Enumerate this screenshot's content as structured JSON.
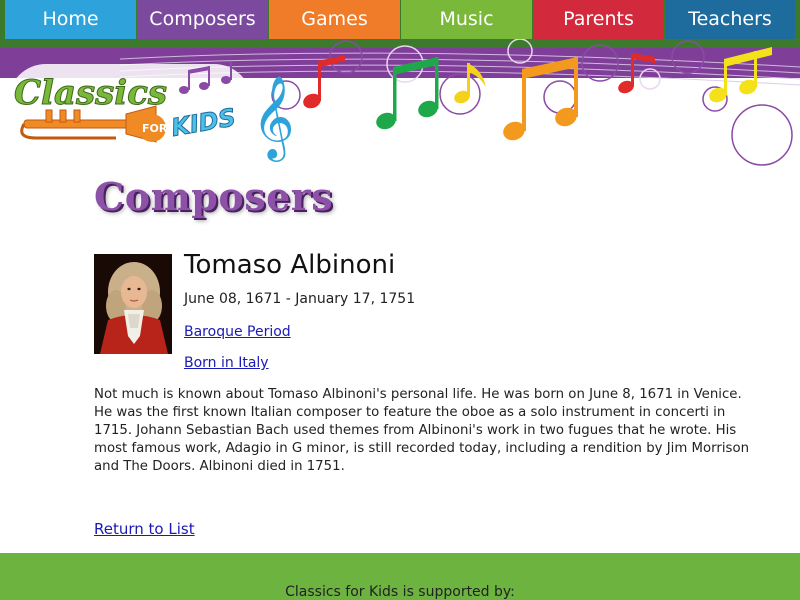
{
  "nav": {
    "items": [
      {
        "label": "Home",
        "color": "#2ea3db"
      },
      {
        "label": "Composers",
        "color": "#7b4a9e"
      },
      {
        "label": "Games",
        "color": "#f07b28"
      },
      {
        "label": "Music",
        "color": "#7ab83a"
      },
      {
        "label": "Parents",
        "color": "#d2293c"
      },
      {
        "label": "Teachers",
        "color": "#1e6c9e"
      }
    ]
  },
  "logo": {
    "text_main": "Classics",
    "text_for": "FOR",
    "text_kids": "KIDS",
    "icon": "trumpet-icon"
  },
  "page": {
    "title": "Composers"
  },
  "composer": {
    "name": "Tomaso Albinoni",
    "dates": "June 08, 1671 - January 17, 1751",
    "period_link": "Baroque Period",
    "born_link": "Born in Italy",
    "bio": "Not much is known about Tomaso Albinoni's personal life. He was born on June 8, 1671 in Venice. He was the first known Italian composer to feature the oboe as a solo instrument in concerti in 1715. Johann Sebastian Bach used themes from Albinoni's work in two fugues that he wrote. His most famous work, Adagio in G minor, is still recorded today, including a rendition by Jim Morrison and The Doors. Albinoni died in 1751."
  },
  "return_link": "Return to List",
  "footer": {
    "supported_text": "Classics for Kids is supported by:"
  },
  "colors": {
    "purple": "#7f3f98",
    "footer_green": "#6db33f",
    "link": "#1a1ab5",
    "title_purple": "#8d52a8"
  }
}
